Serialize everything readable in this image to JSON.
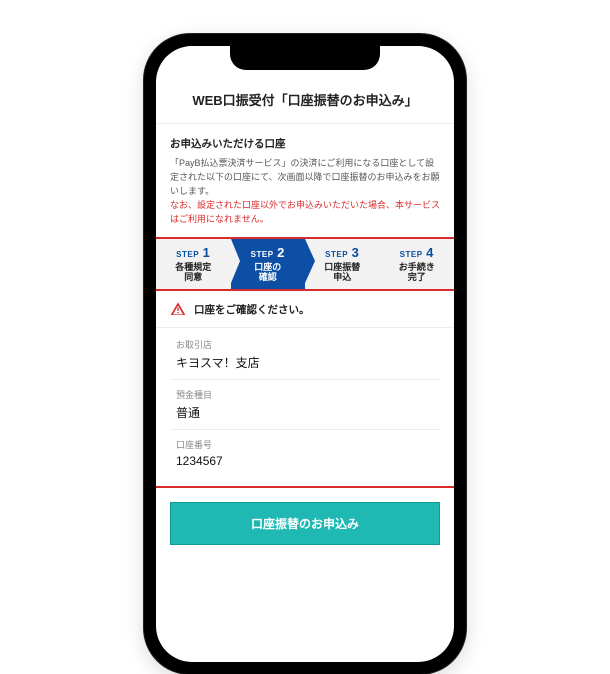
{
  "title": "WEB口振受付「口座振替のお申込み」",
  "section_heading": "お申込みいただける口座",
  "description_plain": "「PayB払込票決済サービス」の決済にご利用になる口座として設定された以下の口座にて、次画面以降で口座振替のお申込みをお願いします。",
  "description_warn": "なお、設定された口座以外でお申込みいただいた場合、本サービスはご利用になれません。",
  "steps": [
    {
      "num_prefix": "STEP",
      "num": "1",
      "label": "各種規定\n同意"
    },
    {
      "num_prefix": "STEP",
      "num": "2",
      "label": "口座の\n確認"
    },
    {
      "num_prefix": "STEP",
      "num": "3",
      "label": "口座振替\n申込"
    },
    {
      "num_prefix": "STEP",
      "num": "4",
      "label": "お手続き\n完了"
    }
  ],
  "active_step_index": 1,
  "alert_text": "口座をご確認ください。",
  "fields": [
    {
      "label": "お取引店",
      "value": "キヨスマ！支店"
    },
    {
      "label": "預金種目",
      "value": "普通"
    },
    {
      "label": "口座番号",
      "value": "1234567"
    }
  ],
  "cta_label": "口座振替のお申込み"
}
